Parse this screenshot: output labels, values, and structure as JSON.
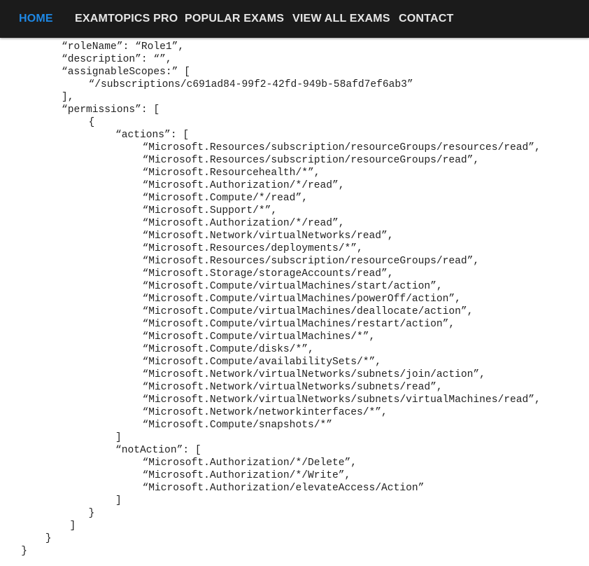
{
  "nav": {
    "items": [
      {
        "label": "HOME",
        "active": true
      },
      {
        "label": "EXAMTOPICS PRO",
        "active": false
      },
      {
        "label": "POPULAR EXAMS",
        "active": false
      },
      {
        "label": "VIEW ALL EXAMS",
        "active": false
      },
      {
        "label": "CONTACT",
        "active": false
      }
    ],
    "active_color": "#1e88e5",
    "background": "#1b1b1b"
  },
  "code": {
    "lines": [
      {
        "indent": 2,
        "text": "“roleName”: “Role1”,"
      },
      {
        "indent": 2,
        "text": "“description”: “”,"
      },
      {
        "indent": 2,
        "text": "“assignableScopes:” ["
      },
      {
        "indent": 3,
        "text": "“/subscriptions/c691ad84-99f2-42fd-949b-58afd7ef6ab3”"
      },
      {
        "indent": 2,
        "text": "],"
      },
      {
        "indent": 2,
        "text": "“permissions”: ["
      },
      {
        "indent": 3,
        "text": "{"
      },
      {
        "indent": 4,
        "text": "“actions”: ["
      },
      {
        "indent": 5,
        "text": "“Microsoft.Resources/subscription/resourceGroups/resources/read”,"
      },
      {
        "indent": 5,
        "text": "“Microsoft.Resources/subscription/resourceGroups/read”,"
      },
      {
        "indent": 5,
        "text": "“Microsoft.Resourcehealth/*”,"
      },
      {
        "indent": 5,
        "text": "“Microsoft.Authorization/*/read”,"
      },
      {
        "indent": 5,
        "text": "“Microsoft.Compute/*/read”,"
      },
      {
        "indent": 5,
        "text": "“Microsoft.Support/*”,"
      },
      {
        "indent": 5,
        "text": "“Microsoft.Authorization/*/read”,"
      },
      {
        "indent": 5,
        "text": "“Microsoft.Network/virtualNetworks/read”,"
      },
      {
        "indent": 5,
        "text": "“Microsoft.Resources/deployments/*”,"
      },
      {
        "indent": 5,
        "text": "“Microsoft.Resources/subscription/resourceGroups/read”,"
      },
      {
        "indent": 5,
        "text": "“Microsoft.Storage/storageAccounts/read”,"
      },
      {
        "indent": 5,
        "text": "“Microsoft.Compute/virtualMachines/start/action”,"
      },
      {
        "indent": 5,
        "text": "“Microsoft.Compute/virtualMachines/powerOff/action”,"
      },
      {
        "indent": 5,
        "text": "“Microsoft.Compute/virtualMachines/deallocate/action”,"
      },
      {
        "indent": 5,
        "text": "“Microsoft.Compute/virtualMachines/restart/action”,"
      },
      {
        "indent": 5,
        "text": "“Microsoft.Compute/virtualMachines/*”,"
      },
      {
        "indent": 5,
        "text": "“Microsoft.Compute/disks/*”,"
      },
      {
        "indent": 5,
        "text": "“Microsoft.Compute/availabilitySets/*”,"
      },
      {
        "indent": 5,
        "text": "“Microsoft.Network/virtualNetworks/subnets/join/action”,"
      },
      {
        "indent": 5,
        "text": "“Microsoft.Network/virtualNetworks/subnets/read”,"
      },
      {
        "indent": 5,
        "text": "“Microsoft.Network/virtualNetworks/subnets/virtualMachines/read”,"
      },
      {
        "indent": 5,
        "text": "“Microsoft.Network/networkinterfaces/*”,"
      },
      {
        "indent": 5,
        "text": "“Microsoft.Compute/snapshots/*”"
      },
      {
        "indent": 4,
        "text": "]"
      },
      {
        "indent": 4,
        "text": "“notAction”: ["
      },
      {
        "indent": 5,
        "text": "“Microsoft.Authorization/*/Delete”,"
      },
      {
        "indent": 5,
        "text": "“Microsoft.Authorization/*/Write”,"
      },
      {
        "indent": 5,
        "text": "“Microsoft.Authorization/elevateAccess/Action”"
      },
      {
        "indent": 4,
        "text": "]"
      },
      {
        "indent": 3,
        "text": "}"
      },
      {
        "indent": 2.3,
        "text": "]"
      },
      {
        "indent": 1.4,
        "text": "}"
      },
      {
        "indent": 0.5,
        "text": "}"
      }
    ]
  }
}
